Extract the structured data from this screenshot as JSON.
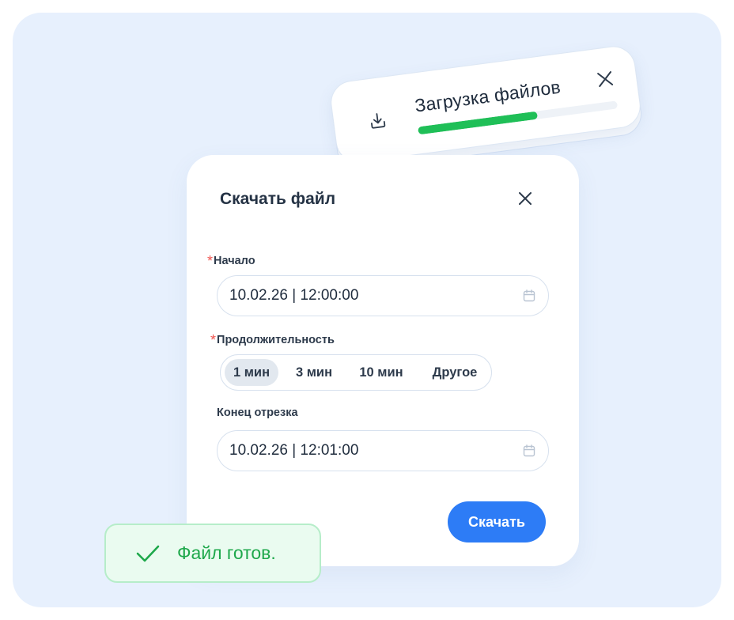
{
  "upload_toast": {
    "title": "Загрузка файлов",
    "progress": 0.6,
    "icons": {
      "download": "download-icon",
      "close": "close-icon"
    },
    "colors": {
      "progress": "#1fbf57",
      "track": "#eef2f7"
    }
  },
  "dialog": {
    "title": "Скачать файл",
    "start": {
      "required_mark": "*",
      "label": "Начало",
      "value": "10.02.26 | 12:00:00"
    },
    "duration": {
      "required_mark": "*",
      "label": "Продолжительность",
      "options": [
        "1 мин",
        "3 мин",
        "10 мин",
        "Другое"
      ],
      "selected": "1 мин"
    },
    "end": {
      "label": "Конец отрезка",
      "value": "10.02.26 | 12:01:00"
    },
    "download_button": "Скачать",
    "icons": {
      "close": "close-icon",
      "calendar": "calendar-icon"
    }
  },
  "success_toast": {
    "text": "Файл готов.",
    "icon": "checkmark-icon"
  },
  "colors": {
    "background": "#e7f0fd",
    "accent": "#2d7cf6",
    "success": "#1ea84b",
    "required": "#f0544f"
  }
}
